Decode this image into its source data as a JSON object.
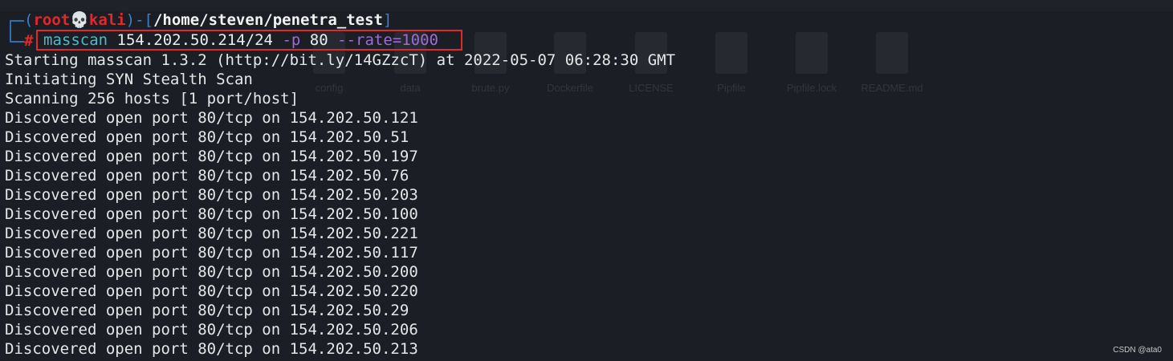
{
  "prompt": {
    "user": "root",
    "skull": "💀",
    "host": "kali",
    "path": "/home/steven/penetra_test",
    "symbol": "#"
  },
  "command": {
    "name": "masscan",
    "target": "154.202.50.214/24",
    "port_flag": "-p",
    "port": "80",
    "rate_flag": "--rate=1000"
  },
  "output": [
    "Starting masscan 1.3.2 (http://bit.ly/14GZzcT) at 2022-05-07 06:28:30 GMT",
    "Initiating SYN Stealth Scan",
    "Scanning 256 hosts [1 port/host]",
    "Discovered open port 80/tcp on 154.202.50.121",
    "Discovered open port 80/tcp on 154.202.50.51",
    "Discovered open port 80/tcp on 154.202.50.197",
    "Discovered open port 80/tcp on 154.202.50.76",
    "Discovered open port 80/tcp on 154.202.50.203",
    "Discovered open port 80/tcp on 154.202.50.100",
    "Discovered open port 80/tcp on 154.202.50.221",
    "Discovered open port 80/tcp on 154.202.50.117",
    "Discovered open port 80/tcp on 154.202.50.200",
    "Discovered open port 80/tcp on 154.202.50.220",
    "Discovered open port 80/tcp on 154.202.50.29",
    "Discovered open port 80/tcp on 154.202.50.206",
    "Discovered open port 80/tcp on 154.202.50.213"
  ],
  "desktop_ghost": [
    "config",
    "data",
    "brute.py",
    "Dockerfile",
    "LICENSE",
    "Pipfile",
    "Pipfile.lock",
    "README.md"
  ],
  "watermark": "CSDN @ata0",
  "colors": {
    "background": "#1b1e25",
    "prompt_bracket": "#3f7ec9",
    "user_host": "#e0292d",
    "command_name": "#53b7c4",
    "command_option": "#9f6bd6",
    "highlight_box": "#e02a2a"
  }
}
